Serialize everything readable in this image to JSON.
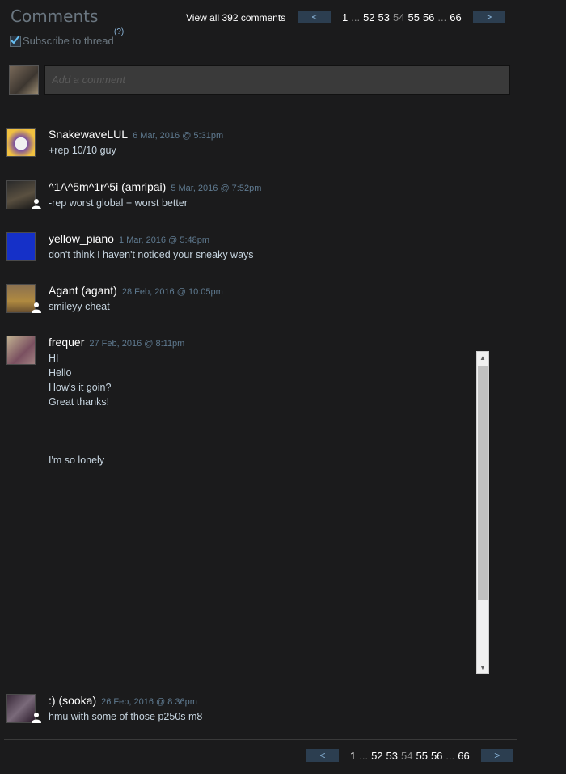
{
  "section_title": "Comments",
  "subscribe": {
    "label": "Subscribe to thread",
    "checked": true,
    "help": "(?)"
  },
  "view_all": "View all 392 comments",
  "pagination": {
    "prev": "<",
    "next": ">",
    "first": "1",
    "ellipsis": "...",
    "pages": [
      "52",
      "53",
      "54",
      "55",
      "56"
    ],
    "current": "54",
    "last": "66"
  },
  "comment_input": {
    "placeholder": "Add a comment"
  },
  "comments": [
    {
      "author": "SnakewaveLUL",
      "timestamp": "6 Mar, 2016 @ 5:31pm",
      "text": "+rep 10/10 guy",
      "friend": false
    },
    {
      "author": "^1A^5m^1r^5i (amripai)",
      "timestamp": "5 Mar, 2016 @ 7:52pm",
      "text": "-rep worst global + worst better",
      "friend": true
    },
    {
      "author": "yellow_piano",
      "timestamp": "1 Mar, 2016 @ 5:48pm",
      "text": "don't think I haven't noticed your sneaky ways",
      "friend": false
    },
    {
      "author": "Agant (agant)",
      "timestamp": "28 Feb, 2016 @ 10:05pm",
      "text": "smileyy cheat",
      "friend": true
    },
    {
      "author": "frequer",
      "timestamp": "27 Feb, 2016 @ 8:11pm",
      "text": "HI\nHello\nHow's it goin?\nGreat thanks!\n\n\n\nI'm so lonely",
      "friend": false
    },
    {
      "author": ":) (sooka)",
      "timestamp": "26 Feb, 2016 @ 8:36pm",
      "text": "hmu with some of those p250s m8",
      "friend": true
    }
  ],
  "colors": {
    "background": "#1b1b1c",
    "name": "#ffffff",
    "timestamp": "#5f7a90",
    "text": "#c6d4df",
    "pager_button": "#2c3e50"
  }
}
